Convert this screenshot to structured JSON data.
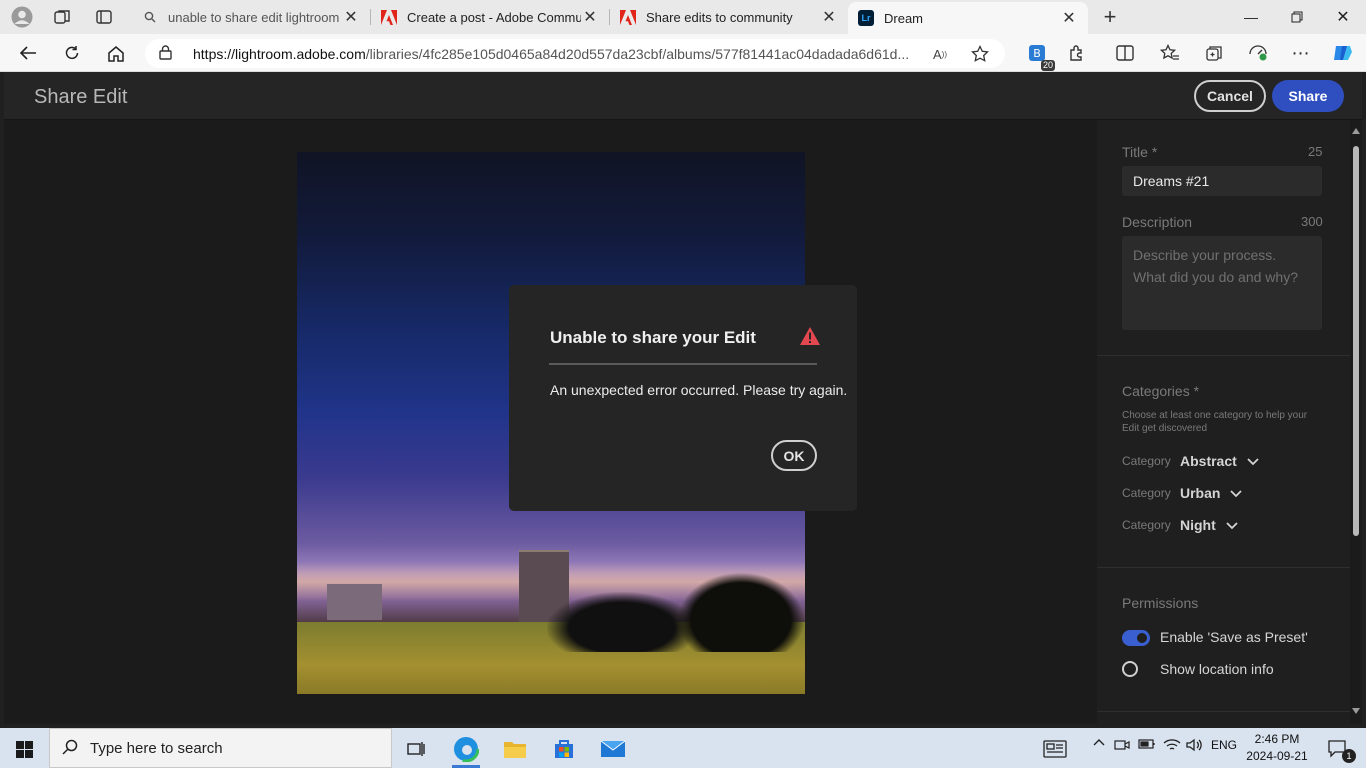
{
  "browser": {
    "tabs": [
      {
        "title": "unable to share edit lightroom co",
        "favicon": "search-icon"
      },
      {
        "title": "Create a post - Adobe Communit",
        "favicon": "adobe-icon"
      },
      {
        "title": "Share edits to community",
        "favicon": "adobe-icon"
      },
      {
        "title": "Dream",
        "favicon": "lightroom-icon",
        "active": true
      }
    ],
    "url_host": "https://lightroom.adobe.com",
    "url_rest": "/libraries/4fc285e105d0465a84d20d557da23cbf/albums/577f81441ac04dadada6d61d...",
    "extension_badge": "20",
    "lr_favicon_text": "Lr"
  },
  "app": {
    "header_title": "Share Edit",
    "cancel_label": "Cancel",
    "share_label": "Share",
    "accent_color": "#2f4fc0",
    "panel": {
      "title_label": "Title *",
      "title_count": "25",
      "title_value": "Dreams #21",
      "description_label": "Description",
      "description_count": "300",
      "description_placeholder": "Describe your process. What did you do and why?",
      "categories_label": "Categories *",
      "categories_hint": "Choose at least one category to help your Edit get discovered",
      "categories": [
        {
          "key": "Category",
          "value": "Abstract"
        },
        {
          "key": "Category",
          "value": "Urban"
        },
        {
          "key": "Category",
          "value": "Night"
        }
      ],
      "permissions_label": "Permissions",
      "permissions": [
        {
          "label": "Enable 'Save as Preset'",
          "enabled": true
        },
        {
          "label": "Show location info",
          "enabled": false
        }
      ]
    },
    "dialog": {
      "title": "Unable to share your Edit",
      "message": "An unexpected error occurred. Please try again.",
      "ok_label": "OK",
      "warning_color": "#e34850"
    }
  },
  "taskbar": {
    "search_placeholder": "Type here to search",
    "language": "ENG",
    "time": "2:46 PM",
    "date": "2024-09-21",
    "notification_count": "1"
  }
}
